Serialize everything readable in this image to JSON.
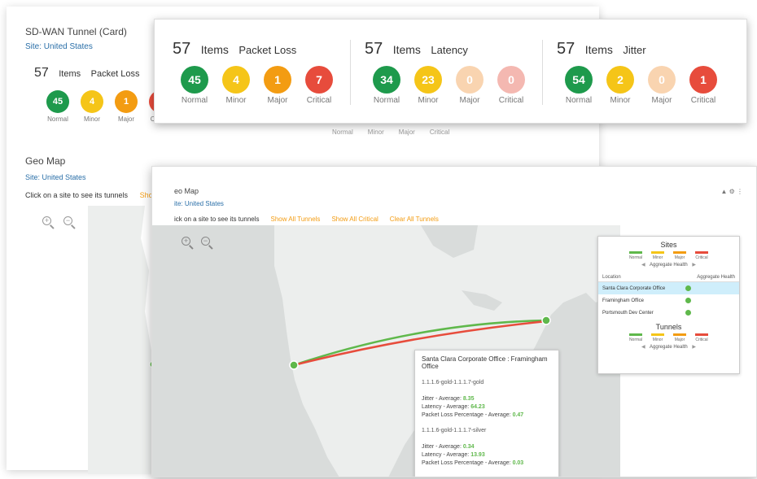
{
  "background_card": {
    "title": "SD-WAN Tunnel (Card)",
    "site": "Site: United States",
    "count": "57",
    "items_label": "Items",
    "metric": "Packet Loss",
    "statuses": [
      {
        "label": "Normal",
        "value": "45",
        "color": "#1e9a4c"
      },
      {
        "label": "Minor",
        "value": "4",
        "color": "#f5c518"
      },
      {
        "label": "Major",
        "value": "1",
        "color": "#f39c12"
      },
      {
        "label": "Critical",
        "value": "7",
        "color": "#e74c3c"
      }
    ],
    "geo_title": "Geo Map",
    "geo_site": "Site: United States",
    "geo_click": "Click on a site to see its tunnels",
    "geo_show": "Show",
    "dim_labels": [
      "Normal",
      "Minor",
      "Major",
      "Critical"
    ]
  },
  "status_card": {
    "groups": [
      {
        "count": "57",
        "items_label": "Items",
        "metric": "Packet Loss",
        "statuses": [
          {
            "label": "Normal",
            "value": "45",
            "color": "#1e9a4c"
          },
          {
            "label": "Minor",
            "value": "4",
            "color": "#f5c518"
          },
          {
            "label": "Major",
            "value": "1",
            "color": "#f39c12"
          },
          {
            "label": "Critical",
            "value": "7",
            "color": "#e74c3c"
          }
        ]
      },
      {
        "count": "57",
        "items_label": "Items",
        "metric": "Latency",
        "statuses": [
          {
            "label": "Normal",
            "value": "34",
            "color": "#1e9a4c"
          },
          {
            "label": "Minor",
            "value": "23",
            "color": "#f5c518"
          },
          {
            "label": "Major",
            "value": "0",
            "color": "#f9d4b0"
          },
          {
            "label": "Critical",
            "value": "0",
            "color": "#f4b8b1"
          }
        ]
      },
      {
        "count": "57",
        "items_label": "Items",
        "metric": "Jitter",
        "statuses": [
          {
            "label": "Normal",
            "value": "54",
            "color": "#1e9a4c"
          },
          {
            "label": "Minor",
            "value": "2",
            "color": "#f5c518"
          },
          {
            "label": "Major",
            "value": "0",
            "color": "#f9d4b0"
          },
          {
            "label": "Critical",
            "value": "1",
            "color": "#e74c3c"
          }
        ]
      }
    ]
  },
  "map_card": {
    "title": "eo Map",
    "site": "ite: United States",
    "click_text": "ick on a site to see its tunnels",
    "links": [
      "Show All Tunnels",
      "Show All Critical",
      "Clear All Tunnels"
    ],
    "tools": "▲ ⚙ ⋮",
    "legend": {
      "sites_title": "Sites",
      "tunnels_title": "Tunnels",
      "levels": [
        {
          "label": "Normal",
          "color": "#5fb84b"
        },
        {
          "label": "Minor",
          "color": "#f5c518"
        },
        {
          "label": "Major",
          "color": "#f39c12"
        },
        {
          "label": "Critical",
          "color": "#e74c3c"
        }
      ],
      "aggregate_label": "Aggregate Health",
      "table_headers": [
        "Location",
        "Aggregate Health"
      ],
      "locations": [
        "Santa Clara Corporate Office",
        "Framingham Office",
        "Portsmouth Dev Center"
      ]
    },
    "tooltip": {
      "header": "Santa Clara Corporate Office : Framingham Office",
      "tunnel1": "1.1.1.6-gold-1.1.1.7-gold",
      "t1_jitter_label": "Jitter - Average:",
      "t1_jitter": "8.35",
      "t1_latency_label": "Latency - Average:",
      "t1_latency": "64.23",
      "t1_loss_label": "Packet Loss Percentage - Average:",
      "t1_loss": "0.47",
      "tunnel2": "1.1.1.6-gold-1.1.1.7-silver",
      "t2_jitter_label": "Jitter - Average:",
      "t2_jitter": "0.34",
      "t2_latency_label": "Latency - Average:",
      "t2_latency": "13.93",
      "t2_loss_label": "Packet Loss Percentage - Average:",
      "t2_loss": "0.03"
    },
    "line_colors": {
      "green": "#5fb84b",
      "red": "#e74c3c"
    }
  }
}
